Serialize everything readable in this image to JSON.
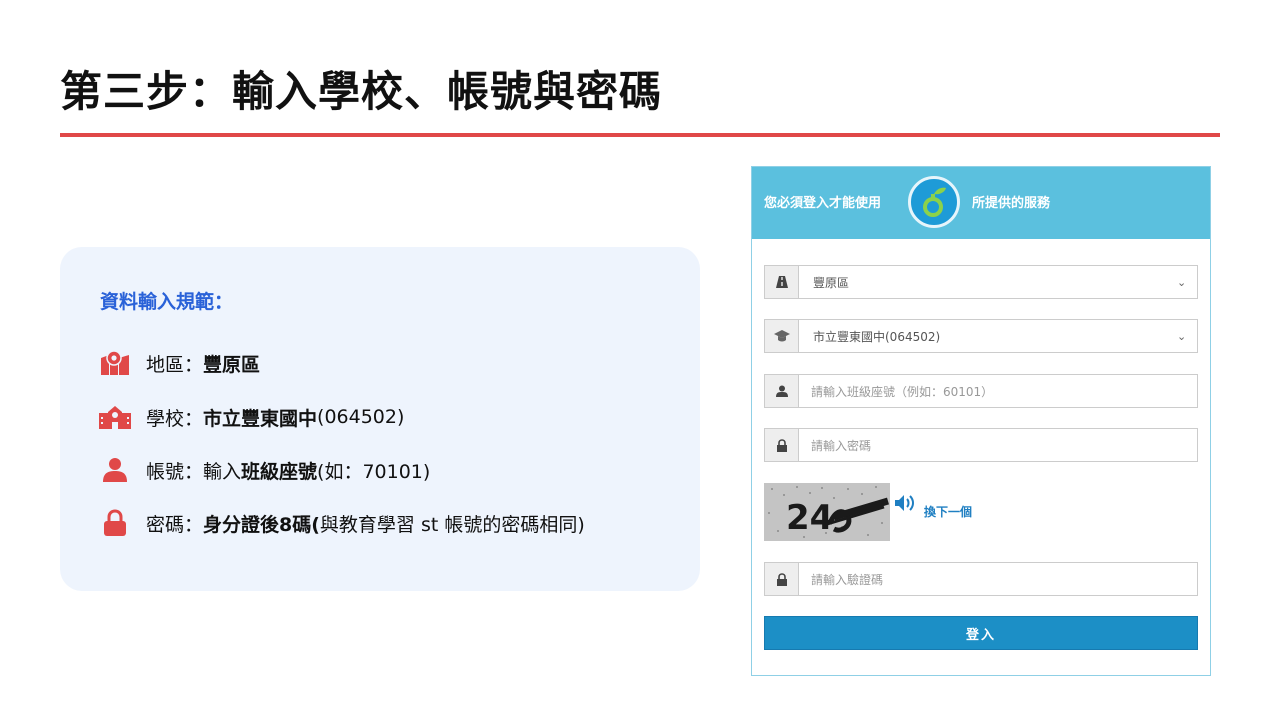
{
  "slide": {
    "title": "第三步：輸入學校、帳號與密碼"
  },
  "info": {
    "heading": "資料輸入規範：",
    "rows": [
      {
        "icon": "map-pin-icon",
        "label": "地區：",
        "bold": "豐原區",
        "rest": ""
      },
      {
        "icon": "school-icon",
        "label": "學校：",
        "bold": "市立豐東國中",
        "rest": " (064502)"
      },
      {
        "icon": "user-icon",
        "label": "帳號：輸入",
        "bold": "班級座號",
        "rest": " (如：70101)"
      },
      {
        "icon": "lock-icon",
        "label": "密碼：",
        "bold": "身分證後8碼(",
        "rest": "與教育學習 st 帳號的密碼相同)"
      }
    ]
  },
  "login": {
    "header_left": "您必須登入才能使用",
    "header_right": "所提供的服務",
    "district_value": "豐原區",
    "school_value": "市立豐東國中(064502)",
    "account_placeholder": "請輸入班級座號（例如：60101）",
    "password_placeholder": "請輸入密碼",
    "captcha_text": "24",
    "refresh_label": "換下一個",
    "captcha_placeholder": "請輸入驗證碼",
    "submit_label": "登入"
  },
  "colors": {
    "accent_red": "#e04848",
    "heading_blue": "#2a62d8",
    "header_cyan": "#5bc0de",
    "button_blue": "#1c8fc6"
  }
}
